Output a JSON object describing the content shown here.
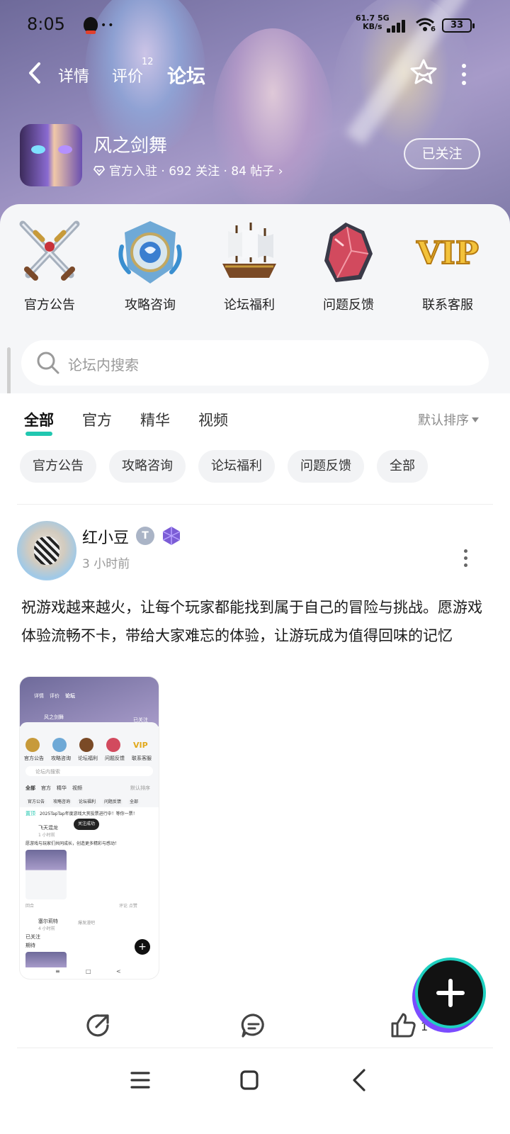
{
  "status_bar": {
    "time": "8:05",
    "dots": "••",
    "net_speed": "61.7",
    "net_unit": "KB/s",
    "net_type": "5G",
    "wifi_label": "6",
    "battery": "33"
  },
  "nav": {
    "tabs": [
      {
        "label": "详情"
      },
      {
        "label": "评价"
      },
      {
        "label": "论坛"
      }
    ],
    "review_count": "12"
  },
  "game": {
    "name": "风之剑舞",
    "meta": "官方入驻 · 692 关注 · 84 帖子",
    "meta_chevron": "›",
    "follow_label": "已关注"
  },
  "shortcuts": [
    {
      "label": "官方公告",
      "icon": "crossed-swords-icon"
    },
    {
      "label": "攻略咨询",
      "icon": "crest-icon"
    },
    {
      "label": "论坛福利",
      "icon": "ship-icon"
    },
    {
      "label": "问题反馈",
      "icon": "red-crystal-icon"
    },
    {
      "label": "联系客服",
      "icon": "vip-icon"
    }
  ],
  "shortcut_vip_text": "VIP",
  "search": {
    "placeholder": "论坛内搜索"
  },
  "feed_tabs": [
    {
      "label": "全部",
      "active": true
    },
    {
      "label": "官方"
    },
    {
      "label": "精华"
    },
    {
      "label": "视频"
    }
  ],
  "sort_label": "默认排序",
  "chips": [
    "官方公告",
    "攻略咨询",
    "论坛福利",
    "问题反馈",
    "全部"
  ],
  "post": {
    "username": "红小豆",
    "level_badge": "T",
    "time": "3 小时前",
    "content": "祝游戏越来越火，让每个玩家都能找到属于自己的冒险与挑战。愿游戏体验流畅不卡，带给大家难忘的体验，让游玩成为值得回味的记忆",
    "like_count": "1",
    "screenshot": {
      "tabs": [
        "详情",
        "评价",
        "论坛"
      ],
      "game_name": "风之剑舞",
      "follow": "已关注",
      "shortcuts": [
        "官方公告",
        "攻略咨询",
        "论坛福利",
        "问题反馈",
        "联系客服"
      ],
      "vip_text": "VIP",
      "search": "论坛内搜索",
      "tabs2": [
        "全部",
        "官方",
        "精华",
        "视频"
      ],
      "sort": "默认排序",
      "chips": [
        "官方公告",
        "攻略咨询",
        "论坛福利",
        "问题反馈",
        "全部"
      ],
      "pin_tag": "置顶",
      "pin": "2025TapTap年度游戏大赏投票进行中！等你一票！",
      "toast": "关注成功",
      "user1": "飞天混龙",
      "user1_time": "1 小时前",
      "user1_text": "愿游戏与玩家们共同成长，创造更多精彩与感动！",
      "row_label": "回合",
      "row_actions": "评论   点赞",
      "user2": "塞尔莉特",
      "user2_tag": "爆发漫吧",
      "user2_time": "4 小时前",
      "user2_line1": "已关注",
      "user2_line2": "期待",
      "fab": "+",
      "nav": [
        "≡",
        "□",
        "<"
      ]
    }
  },
  "colors": {
    "accent": "#21c7b0",
    "banner": "#8e86b8",
    "fab": "#121212"
  }
}
